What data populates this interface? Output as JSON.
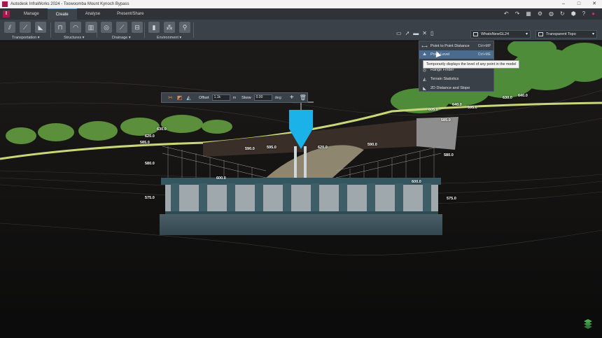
{
  "titlebar": {
    "title": "Autodesk InfraWorks 2024 - Toowoomba Mount Kynoch Bypass",
    "minimize": "–",
    "maximize": "□",
    "close": "✕"
  },
  "app_logo": "I",
  "tabs": [
    {
      "label": "Manage"
    },
    {
      "label": "Create"
    },
    {
      "label": "Analyse"
    },
    {
      "label": "Present/Share"
    }
  ],
  "quick_access_icons": [
    "undo-icon",
    "redo-icon",
    "grid-icon",
    "settings-icon",
    "globe-icon",
    "refresh-icon",
    "cube-icon",
    "help-icon",
    "account-icon"
  ],
  "ribbon": {
    "groups": [
      {
        "label": "Transportation ▾"
      },
      {
        "label": "Structures ▾"
      },
      {
        "label": "Drainage ▾"
      },
      {
        "label": "Environment ▾"
      }
    ],
    "model_dropdown": "WhatsNewGL24",
    "style_dropdown": "Transparent Topo"
  },
  "float_toolbar": {
    "offset_label": "Offset",
    "offset_value": "1.1k",
    "offset_unit": "m",
    "skew_label": "Skew",
    "skew_value": "0.00",
    "skew_unit": "deg"
  },
  "menu": {
    "items": [
      {
        "label": "Point to Point Distance",
        "shortcut": "Ctrl+MP",
        "icon": "ruler-icon"
      },
      {
        "label": "Point Level",
        "shortcut": "Ctrl+ME",
        "icon": "point-level-icon"
      },
      {
        "label": "Range Finder",
        "shortcut": "",
        "icon": "range-finder-icon"
      },
      {
        "label": "Terrain Statistics",
        "shortcut": "",
        "icon": "terrain-stats-icon"
      },
      {
        "label": "2D Distance and Slope",
        "shortcut": "",
        "icon": "distance-slope-icon"
      }
    ],
    "tooltip": "Temporarily displays the level of any point in the model"
  },
  "elevations": [
    "630.0",
    "620.0",
    "585.0",
    "580.0",
    "575.0",
    "590.0",
    "595.0",
    "620.0",
    "590.0",
    "600.0",
    "605.0",
    "640.0",
    "595.0",
    "585.0",
    "580.0",
    "600.0",
    "575.0",
    "630.0",
    "640.0"
  ],
  "colors": {
    "accent": "#a3194d",
    "marker": "#1ab2e8",
    "menu_highlight": "#4b6b8e",
    "bridge": "#3e6773"
  }
}
